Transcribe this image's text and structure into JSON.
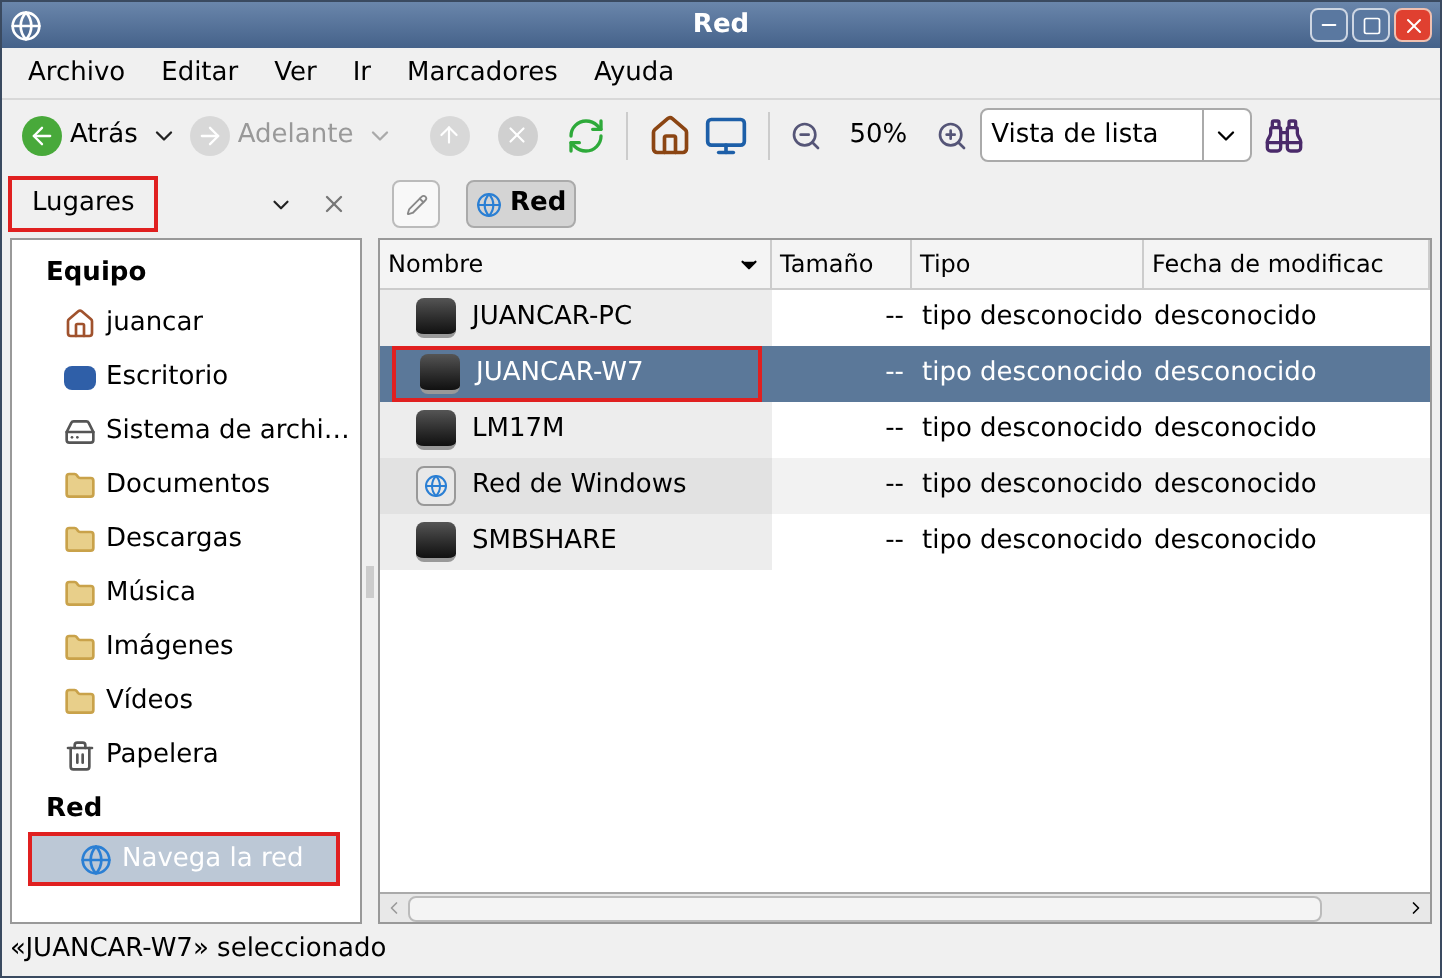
{
  "window": {
    "title": "Red"
  },
  "menu": [
    "Archivo",
    "Editar",
    "Ver",
    "Ir",
    "Marcadores",
    "Ayuda"
  ],
  "toolbar": {
    "back": {
      "label": "Atrás",
      "disabled": false
    },
    "forward": {
      "label": "Adelante",
      "disabled": true
    },
    "zoom": "50%",
    "view": "Vista de lista"
  },
  "location": {
    "side_pane": {
      "value": "Lugares",
      "highlighted": true
    },
    "path": [
      {
        "label": "Red",
        "selected": true
      }
    ]
  },
  "sidebar": {
    "sections": [
      {
        "title": "Equipo",
        "items": [
          {
            "label": "juancar",
            "kind": "home",
            "selected": false,
            "highlighted": false
          },
          {
            "label": "Escritorio",
            "kind": "desktop",
            "selected": false,
            "highlighted": false
          },
          {
            "label": "Sistema de archi…",
            "kind": "drive",
            "selected": false,
            "highlighted": false
          },
          {
            "label": "Documentos",
            "kind": "folder",
            "selected": false,
            "highlighted": false
          },
          {
            "label": "Descargas",
            "kind": "folder",
            "selected": false,
            "highlighted": false
          },
          {
            "label": "Música",
            "kind": "folder",
            "selected": false,
            "highlighted": false
          },
          {
            "label": "Imágenes",
            "kind": "folder",
            "selected": false,
            "highlighted": false
          },
          {
            "label": "Vídeos",
            "kind": "folder",
            "selected": false,
            "highlighted": false
          },
          {
            "label": "Papelera",
            "kind": "trash",
            "selected": false,
            "highlighted": false
          }
        ]
      },
      {
        "title": "Red",
        "items": [
          {
            "label": "Navega la red",
            "kind": "network",
            "selected": true,
            "highlighted": true
          }
        ]
      }
    ]
  },
  "table": {
    "columns": [
      "Nombre",
      "Tamaño",
      "Tipo",
      "Fecha de modificac"
    ],
    "rows": [
      {
        "name": "JUANCAR-PC",
        "kind": "drive",
        "size": "--",
        "type": "tipo desconocido",
        "date": "desconocido",
        "selected": false,
        "highlighted": false
      },
      {
        "name": "JUANCAR-W7",
        "kind": "drive",
        "size": "--",
        "type": "tipo desconocido",
        "date": "desconocido",
        "selected": true,
        "highlighted": true
      },
      {
        "name": "LM17M",
        "kind": "drive",
        "size": "--",
        "type": "tipo desconocido",
        "date": "desconocido",
        "selected": false,
        "highlighted": false
      },
      {
        "name": "Red de Windows",
        "kind": "network",
        "size": "--",
        "type": "tipo desconocido",
        "date": "desconocido",
        "selected": false,
        "highlighted": false
      },
      {
        "name": "SMBSHARE",
        "kind": "drive",
        "size": "--",
        "type": "tipo desconocido",
        "date": "desconocido",
        "selected": false,
        "highlighted": false
      }
    ]
  },
  "status_bar": "«JUANCAR-W7» seleccionado"
}
